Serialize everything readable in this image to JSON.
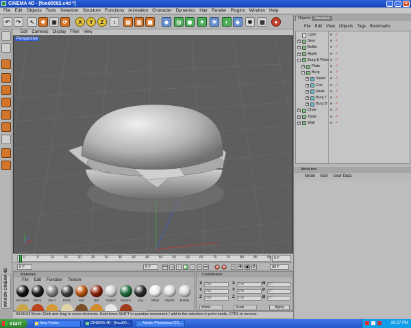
{
  "window": {
    "title": "CINEMA 4D - [food0082.c4d *]",
    "buttons": [
      "_",
      "□",
      "×"
    ]
  },
  "menubar": [
    "File",
    "Edit",
    "Objects",
    "Tools",
    "Selection",
    "Structure",
    "Functions",
    "Animation",
    "Character",
    "Dynamics",
    "Hair",
    "Render",
    "Plugins",
    "Window",
    "Help"
  ],
  "viewport": {
    "menu": [
      "Edit",
      "Cameras",
      "Display",
      "Filter",
      "View"
    ],
    "label": "Perspective"
  },
  "timeline": {
    "ticks": [
      "0",
      "5",
      "10",
      "15",
      "20",
      "25",
      "30",
      "35",
      "40",
      "45",
      "50",
      "55",
      "60",
      "65",
      "70",
      "75",
      "80",
      "85",
      "90"
    ],
    "end_field": "0 F",
    "current_frame": "0 F",
    "start_field": "0 F",
    "end_frame": "90 F"
  },
  "materials": {
    "title": "Materials",
    "menu": [
      "File",
      "Edit",
      "Function",
      "Texture"
    ],
    "items": [
      {
        "label": "Mat black",
        "color": "#111111"
      },
      {
        "label": "Black",
        "color": "#1a1a1a"
      },
      {
        "label": "Mat.1",
        "color": "#7d7d7d"
      },
      {
        "label": "Bottle",
        "color": "#3c3c3c"
      },
      {
        "label": "Mat",
        "color": "#b8520e"
      },
      {
        "label": "Mat",
        "color": "#8a1f0b"
      },
      {
        "label": "Napkin",
        "color": "#cfcfcf"
      },
      {
        "label": "Buttons",
        "color": "#1e6a3a"
      },
      {
        "label": "Cap",
        "color": "#2a2a2a"
      },
      {
        "label": "White",
        "color": "#ececec"
      },
      {
        "label": "Marble",
        "color": "#dcdcdc"
      },
      {
        "label": "Marble",
        "color": "#d5d5d5"
      }
    ]
  },
  "logo": "MAXON CINEMA 4D",
  "coordinates": {
    "title": "Coordinates",
    "rows": [
      {
        "a": "X",
        "av": "0 m",
        "b": "X",
        "bv": "0 m",
        "c": "H",
        "cv": "0 °"
      },
      {
        "a": "Y",
        "av": "0 m",
        "b": "Y",
        "bv": "0 m",
        "c": "P",
        "cv": "0 °"
      },
      {
        "a": "Z",
        "av": "0 m",
        "b": "Z",
        "bv": "0 m",
        "c": "B",
        "cv": "0 °"
      }
    ],
    "mode_world": "World",
    "mode_scale": "Scale",
    "apply": "Apply"
  },
  "objects": {
    "tabs": [
      "Objects",
      "Structure"
    ],
    "menu": [
      "File",
      "Edit",
      "View",
      "Objects",
      "Tags",
      "Bookmarks"
    ],
    "tree": [
      {
        "name": "Light",
        "indent": 0,
        "icon": "#e8e8e8",
        "exp": ""
      },
      {
        "name": "Sew",
        "indent": 0,
        "icon": "#7cc07c",
        "exp": "+"
      },
      {
        "name": "Bottle",
        "indent": 0,
        "icon": "#7cc07c",
        "exp": "+"
      },
      {
        "name": "Apple",
        "indent": 0,
        "icon": "#7cc07c",
        "exp": "+"
      },
      {
        "name": "Burg & Plate",
        "indent": 0,
        "icon": "#7cc07c",
        "exp": "-"
      },
      {
        "name": "Plate",
        "indent": 1,
        "icon": "#7cc07c",
        "exp": "+"
      },
      {
        "name": "Burg",
        "indent": 1,
        "icon": "#7cc07c",
        "exp": "-"
      },
      {
        "name": "Salad",
        "indent": 2,
        "icon": "#62b7c9",
        "exp": "+"
      },
      {
        "name": "Coz",
        "indent": 2,
        "icon": "#62b7c9",
        "exp": "+"
      },
      {
        "name": "Meat",
        "indent": 2,
        "icon": "#62b7c9",
        "exp": "+"
      },
      {
        "name": "Burg T",
        "indent": 2,
        "icon": "#62b7c9",
        "exp": "+"
      },
      {
        "name": "Burg B",
        "indent": 2,
        "icon": "#62b7c9",
        "exp": "+"
      },
      {
        "name": "Chair",
        "indent": 0,
        "icon": "#7cc07c",
        "exp": "+"
      },
      {
        "name": "Table",
        "indent": 0,
        "icon": "#7cc07c",
        "exp": "+"
      },
      {
        "name": "Wall",
        "indent": 0,
        "icon": "#7cc07c",
        "exp": "+"
      }
    ]
  },
  "attributes": {
    "title": "Attributes",
    "menu": [
      "Mode",
      "Edit",
      "User Data"
    ]
  },
  "status": "00:00:02   Move: Click and drag to move elements. Hold down SHIFT to quantize movement / add to the selection in point mode, CTRL to remove.",
  "taskbar": {
    "start": "start",
    "tasks": [
      {
        "label": "New Folder",
        "active": false
      },
      {
        "label": "CINEMA 4D - [food00...",
        "active": true
      },
      {
        "label": "Adobe Photoshop CS...",
        "active": false
      }
    ],
    "clock": "10:27 PM"
  },
  "colors": {
    "accent": "#2e5bd0",
    "viewport_bg": "#5e5e5e",
    "orange_tool": "#d3762b"
  }
}
